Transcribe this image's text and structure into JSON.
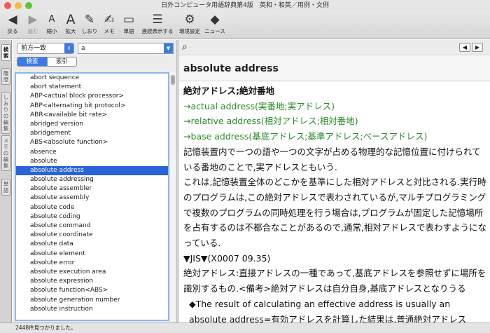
{
  "window": {
    "title": "日外コンピュータ用語辞典第4版　英和・和英／用例・文例"
  },
  "toolbar": [
    {
      "name": "back",
      "icon": "◀",
      "label": "戻る",
      "enabled": true
    },
    {
      "name": "forward",
      "icon": "▶",
      "label": "進む",
      "enabled": false
    },
    {
      "name": "shrink",
      "icon": "A",
      "label": "縮小",
      "enabled": true
    },
    {
      "name": "enlarge",
      "icon": "A",
      "label": "拡大",
      "enabled": true
    },
    {
      "name": "bookmark",
      "icon": "✎",
      "label": "しおり",
      "enabled": true
    },
    {
      "name": "memo",
      "icon": "✍",
      "label": "メモ",
      "enabled": true
    },
    {
      "name": "wordbook",
      "icon": "▭",
      "label": "単語",
      "enabled": true
    },
    {
      "name": "continuous",
      "icon": "☰",
      "label": "連続表示する",
      "enabled": true
    },
    {
      "name": "settings",
      "icon": "⚙",
      "label": "環境設定",
      "enabled": true
    },
    {
      "name": "news",
      "icon": "◆",
      "label": "ニュース",
      "enabled": true
    }
  ],
  "side_tabs": [
    "検索",
    "履歴",
    "しおりの編集",
    "メモの編集",
    "単語"
  ],
  "search": {
    "mode": "前方一致",
    "query": "a",
    "tab_search": "検索",
    "tab_index": "索引"
  },
  "results": [
    "abort sequence",
    "abort statement",
    "ABP<actual block processor>",
    "ABP<alternating bit protocol>",
    "ABR<available bit rate>",
    "abridged version",
    "abridgement",
    "ABS<absolute function>",
    "absence",
    "absolute",
    "absolute address",
    "absolute addressing",
    "absolute assembler",
    "absolute assembly",
    "absolute code",
    "absolute coding",
    "absolute command",
    "absolute coordinate",
    "absolute data",
    "absolute element",
    "absolute error",
    "absolute execution area",
    "absolute expression",
    "absolute function<ABS>",
    "absolute generation number",
    "absolute instruction"
  ],
  "selected_result": "absolute address",
  "entry": {
    "headword": "absolute address",
    "term_ja": "絶対アドレス;絶対番地",
    "refs": [
      "→actual address(実番地;実アドレス)",
      "→relative address(相対アドレス;相対番地)",
      "→base address(基底アドレス;基準アドレス;ベースアドレス)"
    ],
    "definition": "記憶装置内で一つの語や一つの文字が占める物理的な記憶位置に付けられている番地のことで,実アドレスともいう.",
    "explanation": "これは,記憶装置全体のどこかを基準にした相対アドレスと対比される.実行時のプログラムは,この絶対アドレスで表わされているが,マルチプログラミングで複数のプログラムの同時処理を行う場合は,プログラムが固定した記憶場所を占有するのは不都合なことがあるので,通常,相対アドレスで表わすようになっている.",
    "jis": "▼JIS▼(X0007 09.35)",
    "jis_def": "絶対アドレス:直接アドレスの一種であって,基底アドレスを参照せずに場所を識別するもの.<備考>絶対アドレスは自分自身,基底アドレスとなりうる",
    "example": "◆The result of calculating an effective address is usually an absolute address=有効アドレスを計算した結果は,普通絶対アドレス"
  },
  "status": "2448件見つかりました。",
  "colors": {
    "accent": "#3b7be8",
    "selection": "#2a63d8",
    "crossref": "#2d8a2d"
  }
}
